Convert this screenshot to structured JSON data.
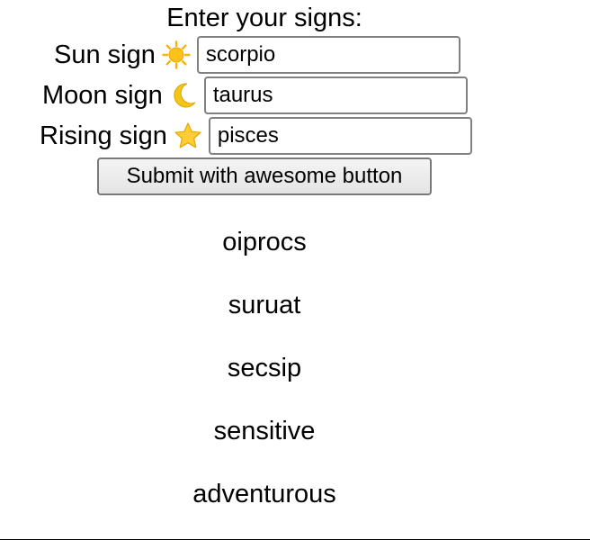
{
  "form": {
    "heading": "Enter your signs:",
    "sun": {
      "label": "Sun sign",
      "icon": "sun-icon",
      "value": "scorpio"
    },
    "moon": {
      "label": "Moon sign",
      "icon": "crescent-moon-icon",
      "value": "taurus"
    },
    "rising": {
      "label": "Rising sign",
      "icon": "star-icon",
      "value": "pisces"
    },
    "submit_label": "Submit with awesome button"
  },
  "results": [
    "oiprocs",
    "suruat",
    "secsip",
    "sensitive",
    "adventurous"
  ],
  "colors": {
    "sun": "#f7b500",
    "moon": "#f5c518",
    "star": "#ffcc33",
    "input_border": "#808080"
  }
}
